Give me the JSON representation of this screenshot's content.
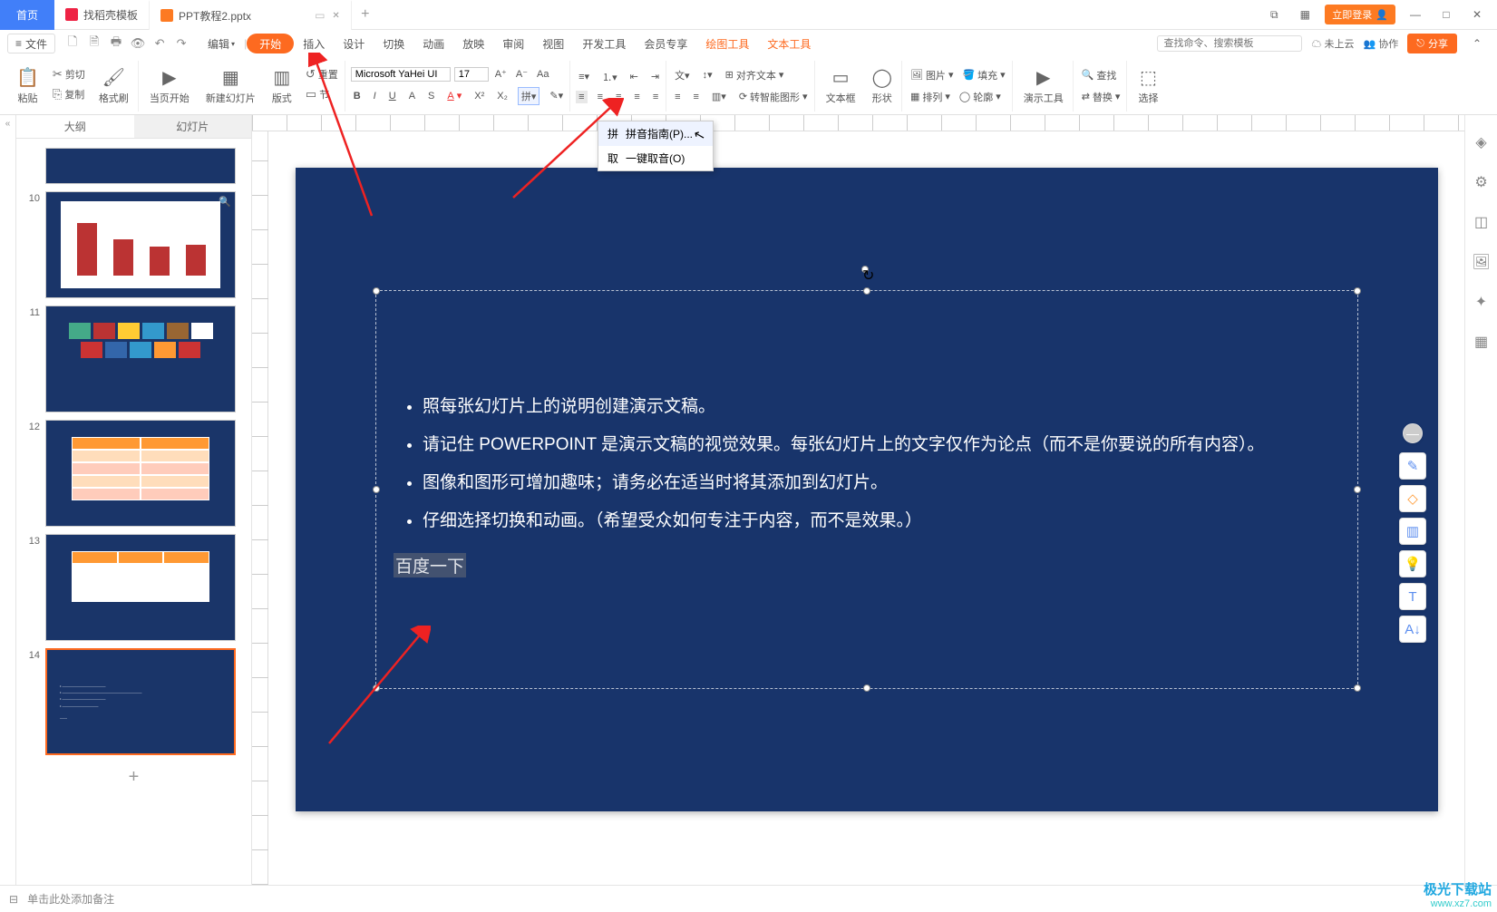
{
  "tabs": {
    "home": "首页",
    "template": "找稻壳模板",
    "doc": "PPT教程2.pptx"
  },
  "titleRight": {
    "login": "立即登录"
  },
  "menu": {
    "file": "文件",
    "edit": "编辑",
    "start": "开始",
    "insert": "插入",
    "design": "设计",
    "transition": "切换",
    "animation": "动画",
    "slideshow": "放映",
    "review": "审阅",
    "view": "视图",
    "dev": "开发工具",
    "member": "会员专享",
    "draw": "绘图工具",
    "text": "文本工具"
  },
  "menuRight": {
    "searchPH": "查找命令、搜索模板",
    "cloud": "未上云",
    "collab": "协作",
    "share": "分享"
  },
  "ribbon": {
    "paste": "粘贴",
    "cut": "剪切",
    "copy": "复制",
    "format": "格式刷",
    "fromCurrent": "当页开始",
    "newSlide": "新建幻灯片",
    "layout": "版式",
    "section": "节",
    "reset": "重置",
    "fontName": "Microsoft YaHei UI",
    "fontSize": "17",
    "alignText": "对齐文本",
    "zhuanZhi": "转智能图形",
    "textBox": "文本框",
    "shape": "形状",
    "picture": "图片",
    "arrange": "排列",
    "fill": "填充",
    "outline": "轮廓",
    "demoTools": "演示工具",
    "find": "查找",
    "replace": "替换",
    "select": "选择"
  },
  "dropdown": {
    "pinyin": "拼音指南(P)...",
    "quyin": "一键取音(O)"
  },
  "panel": {
    "outline": "大纲",
    "slides": "幻灯片"
  },
  "thumbNums": [
    "10",
    "11",
    "12",
    "13",
    "14"
  ],
  "slide": {
    "b1": "照每张幻灯片上的说明创建演示文稿。",
    "b2": "请记住 POWERPOINT 是演示文稿的视觉效果。每张幻灯片上的文字仅作为论点（而不是你要说的所有内容）。",
    "b3": "图像和图形可增加趣味；请务必在适当时将其添加到幻灯片。",
    "b4": "仔细选择切换和动画。（希望受众如何专注于内容，而不是效果。）",
    "sel": "百度一下"
  },
  "status": {
    "notes": "单击此处添加备注"
  },
  "watermark": {
    "l1": "极光下载站",
    "l2": "www.xz7.com"
  }
}
